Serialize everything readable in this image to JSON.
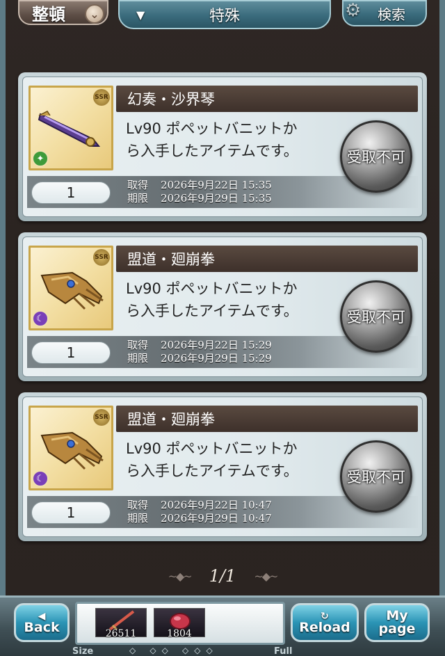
{
  "header": {
    "sort_label": "整頓",
    "filter_label": "特殊",
    "search_label": "検索"
  },
  "items": [
    {
      "name": "幻奏・沙界琴",
      "description_line1": "Lv90 ポペットバニットか",
      "description_line2": "ら入手したアイテムです。",
      "quantity": "1",
      "acquired_label": "取得",
      "acquired_date": "2026年9月22日 15:35",
      "expiry_label": "期限",
      "expiry_date": "2026年9月29日 15:35",
      "claim_label": "受取不可",
      "rarity": "SSR",
      "element": "wind",
      "element_color": "#3e9b3a"
    },
    {
      "name": "盟道・廻崩拳",
      "description_line1": "Lv90 ポペットバニットか",
      "description_line2": "ら入手したアイテムです。",
      "quantity": "1",
      "acquired_label": "取得",
      "acquired_date": "2026年9月22日 15:29",
      "expiry_label": "期限",
      "expiry_date": "2026年9月29日 15:29",
      "claim_label": "受取不可",
      "rarity": "SSR",
      "element": "dark",
      "element_color": "#7a3fb8"
    },
    {
      "name": "盟道・廻崩拳",
      "description_line1": "Lv90 ポペットバニットか",
      "description_line2": "ら入手したアイテムです。",
      "quantity": "1",
      "acquired_label": "取得",
      "acquired_date": "2026年9月22日 10:47",
      "expiry_label": "期限",
      "expiry_date": "2026年9月29日 10:47",
      "claim_label": "受取不可",
      "rarity": "SSR",
      "element": "dark",
      "element_color": "#7a3fb8"
    }
  ],
  "pager": {
    "text": "1/1"
  },
  "footer": {
    "back_label": "Back",
    "reload_label": "Reload",
    "mypage_line1": "My",
    "mypage_line2": "page",
    "resource1_count": "26511",
    "resource2_count": "1804",
    "size_label": "Size",
    "full_label": "Full"
  }
}
